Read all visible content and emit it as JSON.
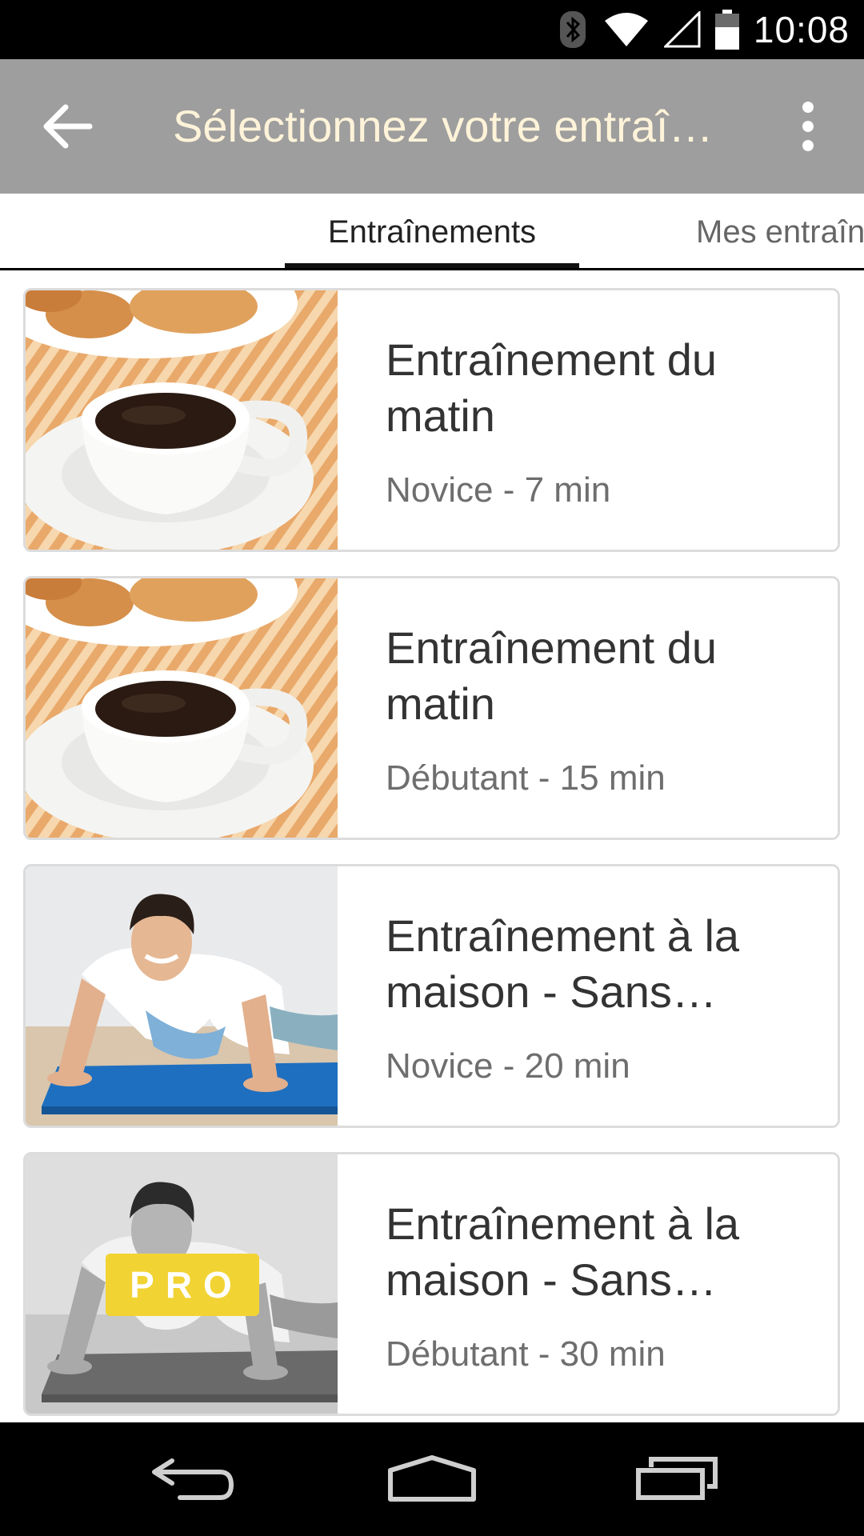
{
  "status_bar": {
    "time": "10:08",
    "icons": [
      "bluetooth-icon",
      "wifi-icon",
      "cell-signal-icon",
      "battery-icon"
    ]
  },
  "app_bar": {
    "title": "Sélectionnez votre entraî…",
    "back_icon": "arrow-back-icon",
    "menu_icon": "overflow-menu-icon",
    "background_color": "#9e9e9e",
    "title_color": "#fff3d9"
  },
  "tabs": [
    {
      "label": "Entraînements",
      "active": true
    },
    {
      "label": "Mes entraîn",
      "active": false
    }
  ],
  "workouts": [
    {
      "title": "Entraînement du matin",
      "subtitle": "Novice - 7 min",
      "image": "coffee-cup-image",
      "pro": false
    },
    {
      "title": "Entraînement du matin",
      "subtitle": "Débutant - 15 min",
      "image": "coffee-cup-image",
      "pro": false
    },
    {
      "title": "Entraînement à la maison - Sans…",
      "subtitle": "Novice - 20 min",
      "image": "pushup-man-image",
      "pro": false
    },
    {
      "title": "Entraînement à la maison - Sans…",
      "subtitle": "Débutant - 30 min",
      "image": "pushup-man-grayscale-image",
      "pro": true,
      "badge": "PRO"
    }
  ],
  "nav_bar": {
    "buttons": [
      "nav-back-icon",
      "nav-home-icon",
      "nav-recents-icon"
    ]
  }
}
